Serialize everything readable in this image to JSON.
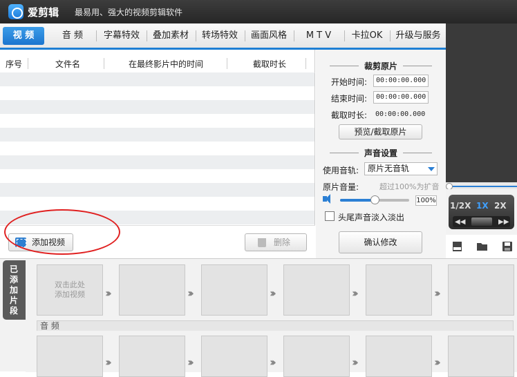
{
  "app": {
    "name": "爱剪辑",
    "slogan": "最易用、强大的视频剪辑软件"
  },
  "tabs": [
    {
      "label": "视 频"
    },
    {
      "label": "音 频"
    },
    {
      "label": "字幕特效"
    },
    {
      "label": "叠加素材"
    },
    {
      "label": "转场特效"
    },
    {
      "label": "画面风格"
    },
    {
      "label": "M T V"
    },
    {
      "label": "卡拉OK"
    },
    {
      "label": "升级与服务"
    }
  ],
  "active_tab": "视 频",
  "file_table": {
    "columns": [
      "序号",
      "文件名",
      "在最终影片中的时间",
      "截取时长"
    ],
    "rows": []
  },
  "buttons": {
    "add_video": "添加视频",
    "delete": "删除",
    "preview_cut": "预览/截取原片",
    "confirm": "确认修改"
  },
  "cut_section": {
    "title": "裁剪原片",
    "start_label": "开始时间:",
    "start_value": "00:00:00.000",
    "end_label": "结束时间:",
    "end_value": "00:00:00.000",
    "duration_label": "截取时长:",
    "duration_value": "00:00:00.000"
  },
  "sound_section": {
    "title": "声音设置",
    "track_label": "使用音轨:",
    "track_value": "原片无音轨",
    "volume_label": "原片音量:",
    "volume_hint": "超过100%为扩音",
    "volume_value": "100%",
    "volume_level": 0.5,
    "fade_label": "头尾声音淡入淡出",
    "fade_checked": false
  },
  "playback": {
    "speeds": [
      "1/2X",
      "1X",
      "2X"
    ],
    "selected_speed": "1X",
    "icons": [
      "new-project-icon",
      "open-folder-icon",
      "save-icon"
    ]
  },
  "timeline": {
    "side_label": "已添加片段",
    "first_clip_hint": "双击此处\n添加视频",
    "audio_label": "音 频"
  },
  "colors": {
    "accent": "#1e7fd4",
    "titlebar": "#2e2e2e",
    "highlight": "#e02020"
  }
}
